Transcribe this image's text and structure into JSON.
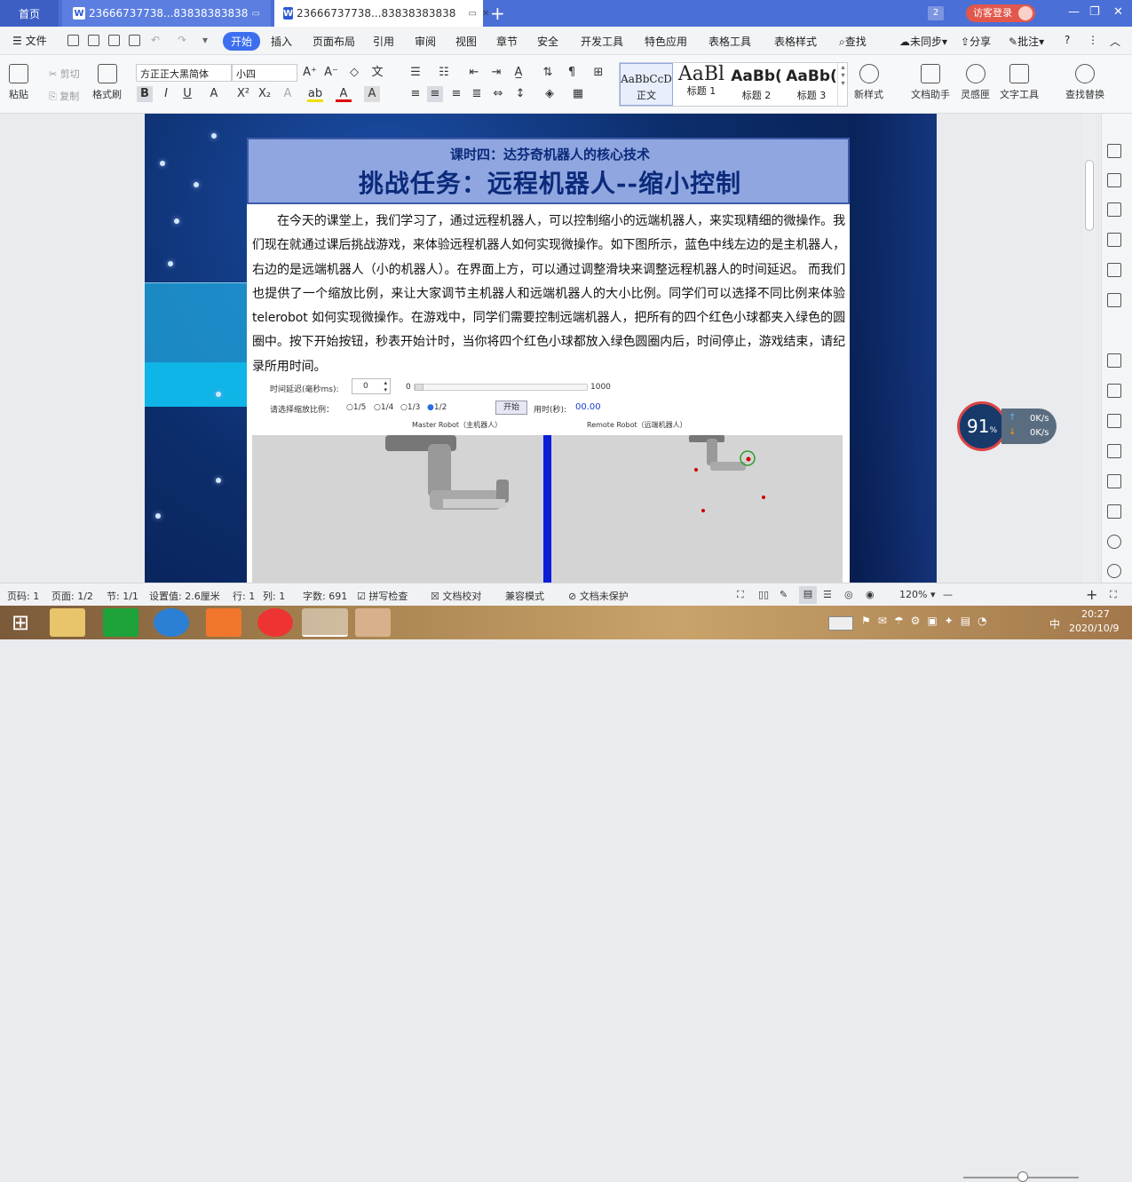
{
  "titlebar": {
    "home_tab": "首页",
    "doc_tab_1": "23666737738...83838383838",
    "doc_tab_2": "23666737738...83838383838",
    "new_tab": "+",
    "page_count": "2",
    "guest_login": "访客登录"
  },
  "menubar": {
    "file": "文件",
    "items": [
      "开始",
      "插入",
      "页面布局",
      "引用",
      "审阅",
      "视图",
      "章节",
      "安全",
      "开发工具",
      "特色应用",
      "表格工具",
      "表格样式"
    ],
    "search": "查找",
    "sync": "未同步",
    "share": "分享",
    "comment": "批注"
  },
  "ribbon": {
    "paste": "粘贴",
    "cut": "剪切",
    "copy": "复制",
    "format_painter": "格式刷",
    "font_name": "方正正大黑简体",
    "font_size": "小四",
    "styles": [
      {
        "preview": "AaBbCcD",
        "name": "正文"
      },
      {
        "preview": "AaBl",
        "name": "标题 1"
      },
      {
        "preview": "AaBb(",
        "name": "标题 2"
      },
      {
        "preview": "AaBb(",
        "name": "标题 3"
      }
    ],
    "new_style": "新样式",
    "doc_assistant": "文档助手",
    "inspiration": "灵感匣",
    "text_tools": "文字工具",
    "find_replace": "查找替换"
  },
  "document": {
    "subtitle": "课时四：达芬奇机器人的核心技术",
    "title": "挑战任务：远程机器人--缩小控制",
    "paragraph": "在今天的课堂上，我们学习了，通过远程机器人，可以控制缩小的远端机器人，来实现精细的微操作。我们现在就通过课后挑战游戏，来体验远程机器人如何实现微操作。如下图所示，蓝色中线左边的是主机器人，右边的是远端机器人（小的机器人）。在界面上方，可以通过调整滑块来调整远程机器人的时间延迟。 而我们也提供了一个缩放比例，来让大家调节主机器人和远端机器人的大小比例。同学们可以选择不同比例来体验 telerobot 如何实现微操作。在游戏中，同学们需要控制远端机器人，把所有的四个红色小球都夹入绿色的圆圈中。按下开始按钮，秒表开始计时，当你将四个红色小球都放入绿色圆圈内后，时间停止，游戏结束，请纪录所用时间。",
    "delay_label": "时间延迟(毫秒ms):",
    "delay_value": "0",
    "slider_min": "0",
    "slider_max": "1000",
    "scale_label": "请选择缩放比例：",
    "scale_options": [
      "1/5",
      "1/4",
      "1/3",
      "1/2"
    ],
    "scale_selected": "1/2",
    "start_button": "开始",
    "time_label": "用时(秒):",
    "time_value": "00.00",
    "master_label": "Master Robot（主机器人）",
    "remote_label": "Remote Robot（远端机器人）"
  },
  "speed_widget": {
    "percent": "91",
    "unit": "%",
    "up": "0K/s",
    "down": "0K/s"
  },
  "statusbar": {
    "page_no": "页码: 1",
    "pages": "页面: 1/2",
    "section": "节: 1/1",
    "setting": "设置值: 2.6厘米",
    "row": "行: 1",
    "col": "列: 1",
    "words": "字数: 691",
    "spell_check": "拼写检查",
    "doc_proof": "文档校对",
    "compat_mode": "兼容模式",
    "unprotected": "文档未保护",
    "zoom": "120%"
  },
  "taskbar": {
    "time": "20:27",
    "date": "2020/10/9",
    "ime": "中"
  },
  "colors": {
    "titlebar": "#4a6fd6",
    "accent": "#3c6ef0",
    "slide_bg": "#0c2d6b",
    "title_band": "#8fa6e0",
    "divider": "#0a1ed8"
  }
}
